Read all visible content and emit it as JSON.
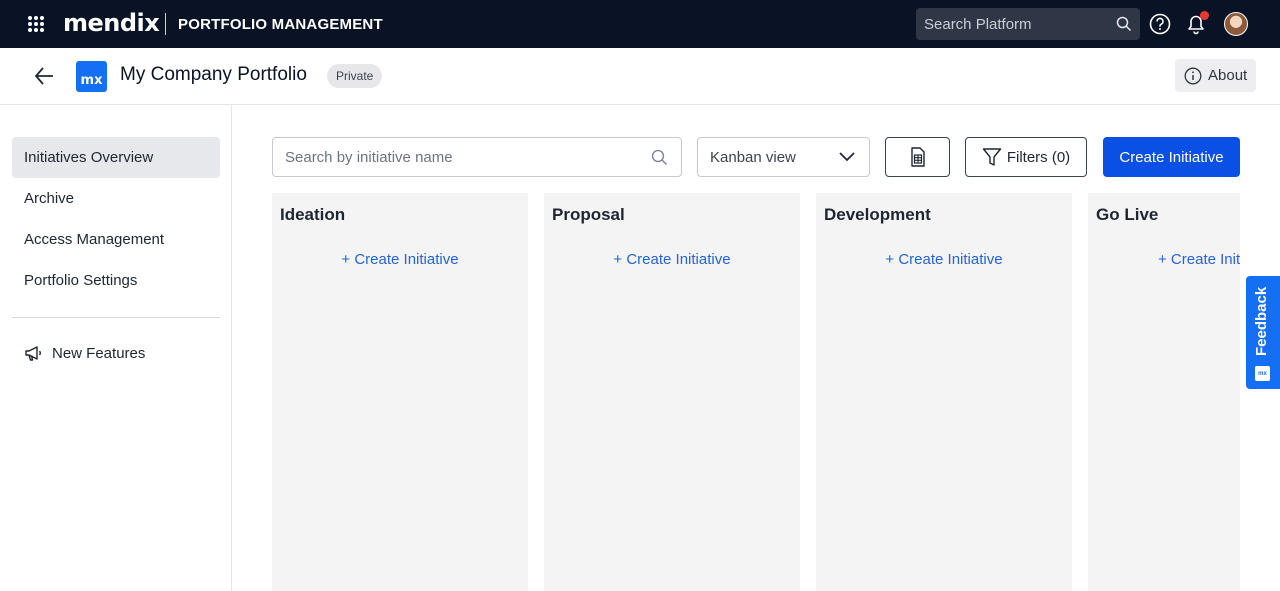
{
  "topbar": {
    "brand": "mendix",
    "app_name": "PORTFOLIO MANAGEMENT",
    "search_placeholder": "Search Platform",
    "notification_dot_color": "#e53935"
  },
  "header": {
    "logo_text": "mx",
    "title": "My Company Portfolio",
    "badge": "Private",
    "about_label": "About"
  },
  "sidebar": {
    "items": [
      {
        "label": "Initiatives Overview",
        "active": true
      },
      {
        "label": "Archive",
        "active": false
      },
      {
        "label": "Access Management",
        "active": false
      },
      {
        "label": "Portfolio Settings",
        "active": false
      }
    ],
    "new_features_label": "New Features"
  },
  "toolbar": {
    "search_placeholder": "Search by initiative name",
    "view_selected": "Kanban view",
    "filters_label": "Filters (0)",
    "create_label": "Create Initiative"
  },
  "board": {
    "columns": [
      {
        "title": "Ideation",
        "create_label": "+ Create Initiative"
      },
      {
        "title": "Proposal",
        "create_label": "+ Create Initiative"
      },
      {
        "title": "Development",
        "create_label": "+ Create Initiative"
      },
      {
        "title": "Go Live",
        "create_label": "+ Create Initiative"
      }
    ]
  },
  "feedback": {
    "label": "Feedback",
    "logo_text": "mx"
  },
  "colors": {
    "topbar_bg": "#0a1325",
    "primary": "#0b50e4",
    "brand_blue": "#146ff4",
    "link": "#2563d8"
  }
}
